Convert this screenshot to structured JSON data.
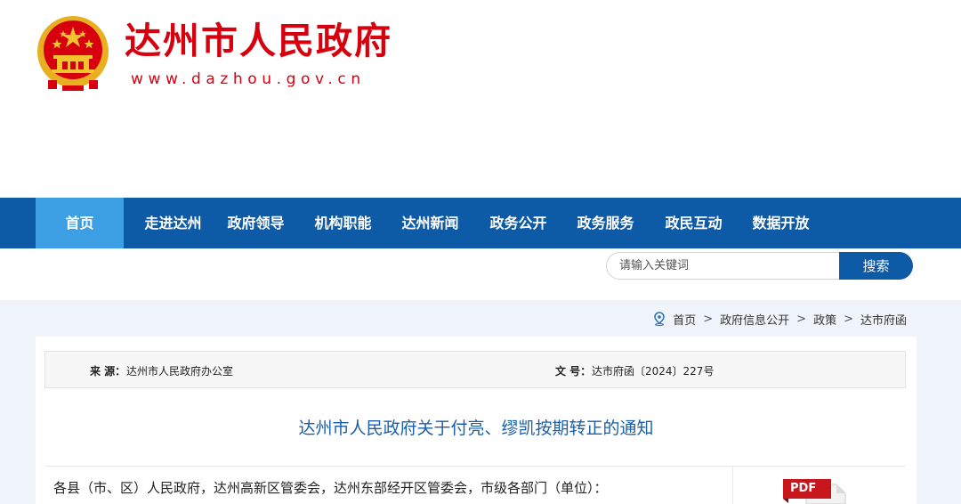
{
  "header": {
    "site_title": "达州市人民政府",
    "site_url": "www.dazhou.gov.cn"
  },
  "nav": {
    "items": [
      {
        "label": "首页",
        "active": true
      },
      {
        "label": "走进达州"
      },
      {
        "label": "政府领导"
      },
      {
        "label": "机构职能"
      },
      {
        "label": "达州新闻"
      },
      {
        "label": "政务公开"
      },
      {
        "label": "政务服务"
      },
      {
        "label": "政民互动"
      },
      {
        "label": "数据开放"
      }
    ]
  },
  "search": {
    "placeholder": "请输入关键词",
    "button_label": "搜索"
  },
  "breadcrumb": {
    "items": [
      "首页",
      "政府信息公开",
      "政策",
      "达市府函"
    ],
    "separator": ">"
  },
  "article": {
    "source_label": "来  源：",
    "source_value": "达州市人民政府办公室",
    "doc_number_label": "文  号：",
    "doc_number_value": "达市府函〔2024〕227号",
    "title": "达州市人民政府关于付亮、缪凯按期转正的通知",
    "body_first_line": "各县（市、区）人民政府，达州高新区管委会，达州东部经开区管委会，市级各部门（单位）：",
    "pdf_label": "PDF"
  },
  "colors": {
    "brand_red": "#d7000f",
    "nav_blue": "#0d5aa7",
    "nav_active": "#3d9fe3",
    "title_blue": "#1a5fa8"
  }
}
